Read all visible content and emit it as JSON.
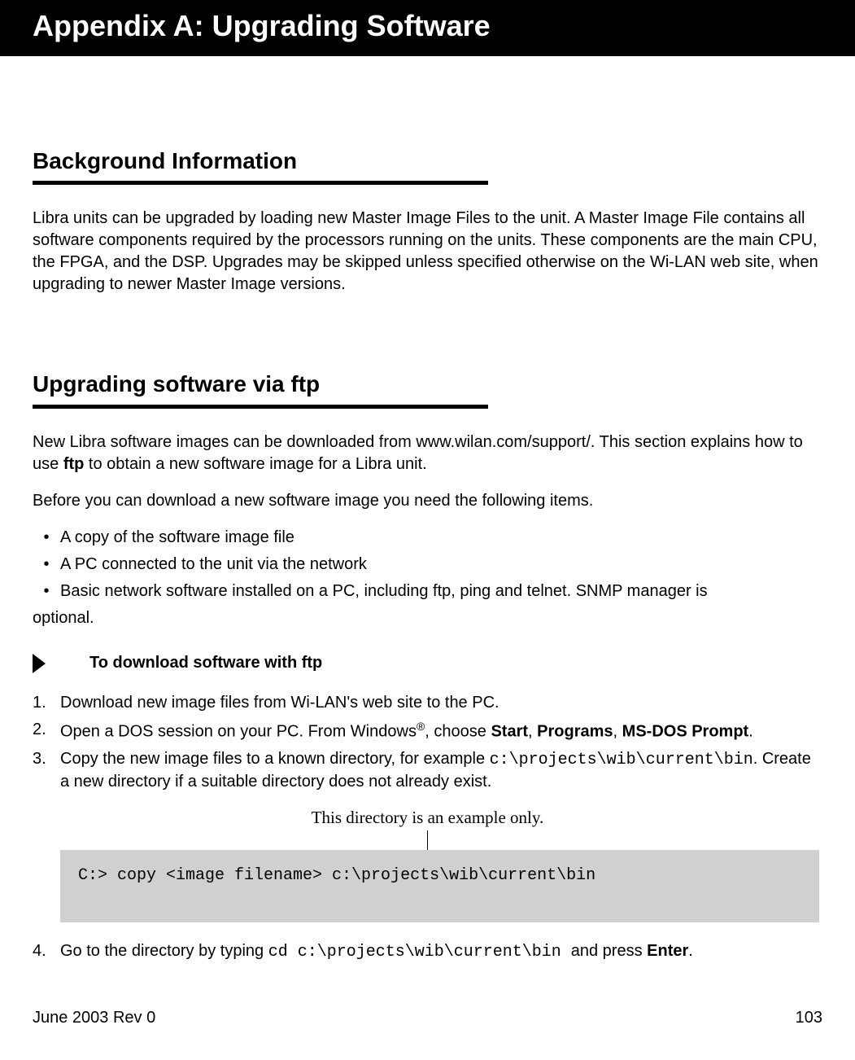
{
  "header": {
    "title": "Appendix A: Upgrading Software"
  },
  "section1": {
    "title": "Background Information",
    "para1": "Libra units can be upgraded by loading new Master Image Files to the unit. A Master Image File contains all software components required by the processors running on the units. These components are the main CPU, the FPGA, and the DSP. Upgrades may be skipped unless specified otherwise on the Wi-LAN web site, when upgrading to newer Master Image versions."
  },
  "section2": {
    "title": "Upgrading software via ftp",
    "para1_pre": "New Libra software images can be downloaded from www.wilan.com/support/. This section explains how to use ",
    "para1_bold": "ftp",
    "para1_post": " to obtain a new software image for a Libra unit.",
    "para2": "Before you can download a new software image you need the following items.",
    "bullets": {
      "b1": "A copy of the software image file",
      "b2": "A PC connected to the unit via the network",
      "b3": "Basic network software installed on a PC, including ftp, ping and telnet. SNMP manager is"
    },
    "bullets_cont": "optional.",
    "procedure_label": "To download software with ftp",
    "steps": {
      "s1": "Download new image files from Wi-LAN's web site to the PC.",
      "s2_a": "Open a DOS session on your PC. From Windows",
      "s2_reg": "®",
      "s2_b": ", choose ",
      "s2_start": "Start",
      "s2_c": ", ",
      "s2_programs": "Programs",
      "s2_d": ", ",
      "s2_msdos": "MS-DOS Prompt",
      "s2_e": ".",
      "s3_a": "Copy the new image files to a known directory, for example ",
      "s3_code": "c:\\projects\\wib\\current\\bin",
      "s3_b": ". Create a new directory if a suitable directory does not already exist.",
      "s4_a": "Go to the directory by typing ",
      "s4_code": " cd c:\\projects\\wib\\current\\bin ",
      "s4_b": " and press ",
      "s4_enter": "Enter",
      "s4_c": "."
    },
    "callout": "This directory is an example only.",
    "command": "C:> copy <image filename> c:\\projects\\wib\\current\\bin"
  },
  "footer": {
    "left": "June 2003 Rev 0",
    "right": "103"
  }
}
